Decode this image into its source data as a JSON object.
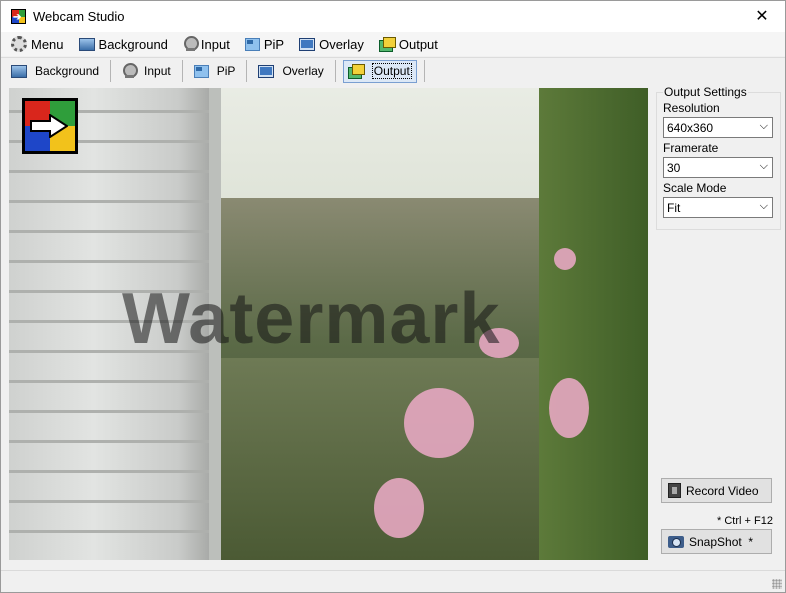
{
  "window": {
    "title": "Webcam Studio"
  },
  "menubar": {
    "items": [
      {
        "label": "Menu",
        "icon": "gear-icon"
      },
      {
        "label": "Background",
        "icon": "background-icon"
      },
      {
        "label": "Input",
        "icon": "webcam-icon"
      },
      {
        "label": "PiP",
        "icon": "pip-icon"
      },
      {
        "label": "Overlay",
        "icon": "overlay-icon"
      },
      {
        "label": "Output",
        "icon": "output-icon"
      }
    ]
  },
  "toolbar": {
    "items": [
      {
        "label": "Background",
        "icon": "background-icon"
      },
      {
        "label": "Input",
        "icon": "webcam-icon"
      },
      {
        "label": "PiP",
        "icon": "pip-icon"
      },
      {
        "label": "Overlay",
        "icon": "overlay-icon"
      },
      {
        "label": "Output",
        "icon": "output-icon",
        "active": true
      }
    ]
  },
  "preview": {
    "watermark_text": "Watermark",
    "logo": "webcam-studio-logo"
  },
  "output_settings": {
    "title": "Output Settings",
    "resolution_label": "Resolution",
    "resolution_value": "640x360",
    "framerate_label": "Framerate",
    "framerate_value": "30",
    "scale_mode_label": "Scale Mode",
    "scale_mode_value": "Fit"
  },
  "actions": {
    "record_label": "Record Video",
    "hotkey_hint": "* Ctrl + F12",
    "snapshot_label": "SnapShot  *"
  },
  "colors": {
    "accent_active": "#dce8f6",
    "logo_red": "#d9261c",
    "logo_green": "#2f9e3b",
    "logo_blue": "#1e46c8",
    "logo_yellow": "#f2c21b"
  }
}
